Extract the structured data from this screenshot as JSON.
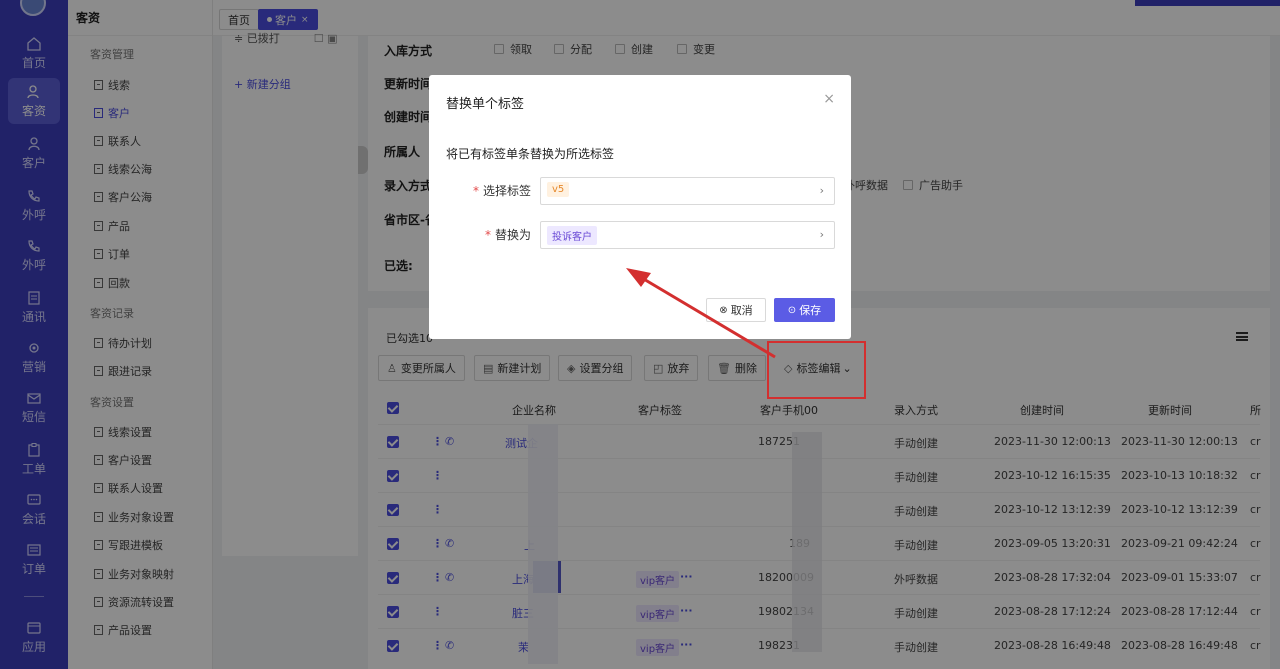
{
  "nav": [
    {
      "label": "首页",
      "icon": "home-icon"
    },
    {
      "label": "客资",
      "icon": "users-icon",
      "active": true
    },
    {
      "label": "客户",
      "icon": "user-icon"
    },
    {
      "label": "外呼",
      "icon": "phone-out-icon"
    },
    {
      "label": "外呼",
      "icon": "phone-in-icon"
    },
    {
      "label": "通讯",
      "icon": "contacts-icon"
    },
    {
      "label": "营销",
      "icon": "marketing-icon"
    },
    {
      "label": "短信",
      "icon": "sms-icon"
    },
    {
      "label": "工单",
      "icon": "ticket-icon"
    },
    {
      "label": "会话",
      "icon": "chat-icon"
    },
    {
      "label": "订单",
      "icon": "order-icon"
    },
    {
      "label": "应用",
      "icon": "app-icon"
    }
  ],
  "sidebar": {
    "title": "客资",
    "group1": "客资管理",
    "items1": [
      "线索",
      "客户",
      "联系人",
      "线索公海",
      "客户公海",
      "产品",
      "订单",
      "回款"
    ],
    "group2": "客资记录",
    "items2": [
      "待办计划",
      "跟进记录"
    ],
    "group3": "客资设置",
    "items3": [
      "线索设置",
      "客户设置",
      "联系人设置",
      "业务对象设置",
      "写跟进模板",
      "业务对象映射",
      "资源流转设置",
      "产品设置"
    ]
  },
  "tabs": {
    "home": "首页",
    "current": "客户",
    "close": "×"
  },
  "groups": {
    "top": "已拨打",
    "new_group": "+ 新建分组"
  },
  "filter": {
    "rows": [
      "入库方式",
      "更新时间",
      "创建时间",
      "所属人",
      "录入方式",
      "省市区-省",
      "已选:"
    ],
    "storage_options": [
      "领取",
      "分配",
      "创建",
      "变更"
    ],
    "entry_options": [
      "外呼数据",
      "广告助手"
    ]
  },
  "list": {
    "selected_info": "已勾选10",
    "actions": [
      "变更所属人",
      "新建计划",
      "设置分组",
      "放弃",
      "删除",
      "标签编辑"
    ],
    "columns": [
      "企业名称",
      "客户标签",
      "客户手机00",
      "录入方式",
      "创建时间",
      "更新时间",
      "所"
    ],
    "rows": [
      {
        "name": "测试企",
        "tag": "",
        "more": "",
        "phone": "187251",
        "entry": "手动创建",
        "created": "2023-11-30 12:00:13",
        "updated": "2023-11-30 12:00:13",
        "owner": "cr"
      },
      {
        "name": "",
        "tag": "",
        "more": "",
        "phone": "",
        "entry": "手动创建",
        "created": "2023-10-12 16:15:35",
        "updated": "2023-10-13 10:18:32",
        "owner": "cr"
      },
      {
        "name": "",
        "tag": "",
        "more": "",
        "phone": "",
        "entry": "手动创建",
        "created": "2023-10-12 13:12:39",
        "updated": "2023-10-12 13:12:39",
        "owner": "cr"
      },
      {
        "name": "上",
        "tag": "",
        "more": "",
        "phone": "189",
        "entry": "手动创建",
        "created": "2023-09-05 13:20:31",
        "updated": "2023-09-21 09:42:24",
        "owner": "cr"
      },
      {
        "name": "上海",
        "tag": "vip客户",
        "more": "···",
        "phone": "18200009",
        "entry": "外呼数据",
        "created": "2023-08-28 17:32:04",
        "updated": "2023-09-01 15:33:07",
        "owner": "cr"
      },
      {
        "name": "脏三",
        "tag": "vip客户",
        "more": "···",
        "phone": "19802134",
        "entry": "手动创建",
        "created": "2023-08-28 17:12:24",
        "updated": "2023-08-28 17:12:44",
        "owner": "cr"
      },
      {
        "name": "茉",
        "tag": "vip客户",
        "more": "···",
        "phone": "198231",
        "entry": "手动创建",
        "created": "2023-08-28 16:49:48",
        "updated": "2023-08-28 16:49:48",
        "owner": "cr"
      }
    ]
  },
  "modal": {
    "title": "替换单个标签",
    "close": "×",
    "hint": "将已有标签单条替换为所选标签",
    "select_label": "选择标签",
    "select_value": "v5",
    "replace_label": "替换为",
    "replace_value": "投诉客户",
    "cancel": "取消",
    "save": "保存"
  },
  "colors": {
    "brand": "#3d3ebd",
    "accent": "#5b5ce5",
    "annotation": "#d32f2f"
  }
}
